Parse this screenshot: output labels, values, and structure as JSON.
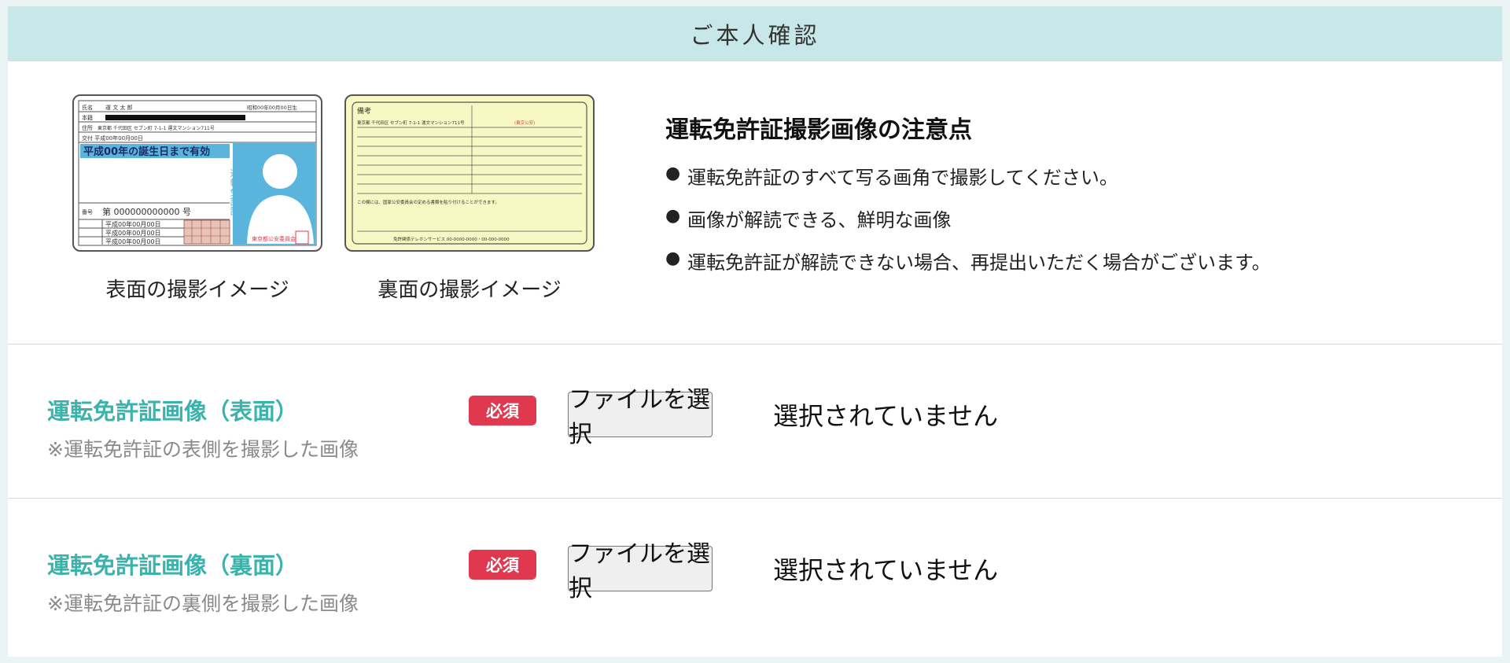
{
  "header": {
    "title": "ご本人確認"
  },
  "samples": {
    "front_caption": "表面の撮影イメージ",
    "back_caption": "裏面の撮影イメージ",
    "front_card": {
      "name_label": "氏名",
      "name_value": "運 文 太 郎",
      "birth": "昭和00年00月00日生",
      "honseki": "本籍",
      "address_label": "住所",
      "address": "東京都 千代田区 セブン町 7-1-1 運文マンション711号",
      "issue": "交付 平成00年00月00日",
      "valid_until": "平成00年の誕生日まで有効",
      "license_word": "運転免許証",
      "number_label": "番号",
      "number": "第 000000000000 号",
      "date1": "平成00年00月00日",
      "date2": "平成00年00月00日",
      "date3": "平成00年00月00日",
      "issuer": "東京都公安委員会"
    },
    "back_card": {
      "remarks": "備考",
      "address": "東京都 千代田区 セブン町 7-1-1 運文マンション711号",
      "stamp": "(東京公安)",
      "note": "この欄には、国家公安委員会の定める書類を貼り付けることができます。",
      "footer": "免許関係テレホンサービス 00-0000-0000・00-000-0000"
    }
  },
  "notes": {
    "title": "運転免許証撮影画像の注意点",
    "items": [
      "運転免許証のすべて写る画角で撮影してください。",
      "画像が解読できる、鮮明な画像",
      "運転免許証が解読できない場合、再提出いただく場合がございます。"
    ]
  },
  "rows": [
    {
      "label": "運転免許証画像（表面）",
      "sub": "※運転免許証の表側を撮影した画像",
      "badge": "必須",
      "button": "ファイルを選択",
      "status": "選択されていません"
    },
    {
      "label": "運転免許証画像（裏面）",
      "sub": "※運転免許証の裏側を撮影した画像",
      "badge": "必須",
      "button": "ファイルを選択",
      "status": "選択されていません"
    }
  ],
  "colors": {
    "header_bg": "#c7e7e8",
    "label_teal": "#3bb3ad",
    "badge_red": "#e0394f",
    "card_blue": "#5ab4dc",
    "back_card_bg": "#f8f8c4"
  }
}
